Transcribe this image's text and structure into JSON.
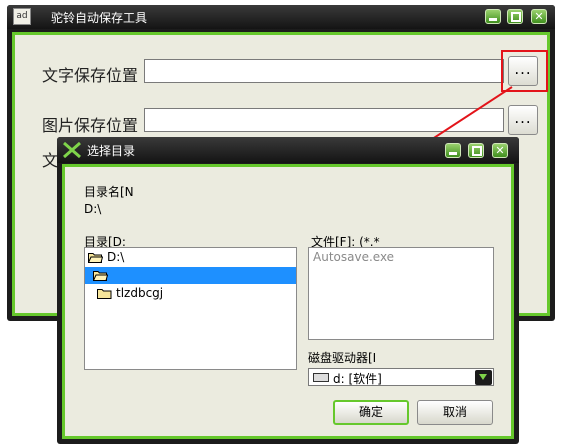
{
  "main_window": {
    "title": "驼铃自动保存工具",
    "icon_text": "ad",
    "controls": [
      "minimize",
      "maximize",
      "close"
    ],
    "text_label": "文字保存位置",
    "text_value": "",
    "image_label": "图片保存位置",
    "image_value": "",
    "third_label_partial": "文",
    "browse_label": "..."
  },
  "dialog": {
    "title": "选择目录",
    "dir_name_label": "目录名[N",
    "dir_name_value": "D:\\",
    "directories_label": "目录[D:",
    "directories": [
      {
        "label": "D:\\",
        "icon": "open-folder-icon",
        "selected": false
      },
      {
        "label": "",
        "icon": "open-folder-icon",
        "selected": true
      },
      {
        "label": "tlzdbcgj",
        "icon": "folder-icon",
        "selected": false
      }
    ],
    "files_label": "文件[F]: (*.*",
    "files": [
      "Autosave.exe"
    ],
    "drives_label": "磁盘驱动器[I",
    "drive_value": "d: [软件]",
    "ok_label": "确定",
    "cancel_label": "取消"
  },
  "colors": {
    "accent_green": "#66c82c",
    "titlebar_dark": "#1c1c1c",
    "face": "#ebebdf",
    "highlight_red": "#e3141a",
    "selection_blue": "#1e90ff"
  }
}
